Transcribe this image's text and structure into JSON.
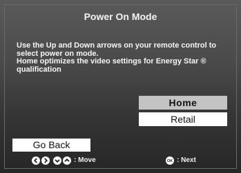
{
  "title": "Power On Mode",
  "instructions": {
    "line1": "Use the Up and Down arrows on your remote control to",
    "line2": "select power on mode.",
    "line3": "Home optimizes the video settings for Energy Star ®",
    "line4": "qualification"
  },
  "options": [
    {
      "label": "Home",
      "selected": true
    },
    {
      "label": "Retail",
      "selected": false
    }
  ],
  "go_back_label": "Go Back",
  "legend": {
    "move_icons": [
      "left-arrow-icon",
      "right-arrow-icon",
      "down-arrow-icon",
      "up-arrow-icon"
    ],
    "move_label": ": Move",
    "ok_icon": "ok-button-icon",
    "ok_icon_text": "OK",
    "next_label": ": Next"
  },
  "colors": {
    "selected_option_bg": "#c3c3c3",
    "option_bg": "#ffffff",
    "background_top": "#5a5a5a",
    "background_bottom": "#262626"
  }
}
